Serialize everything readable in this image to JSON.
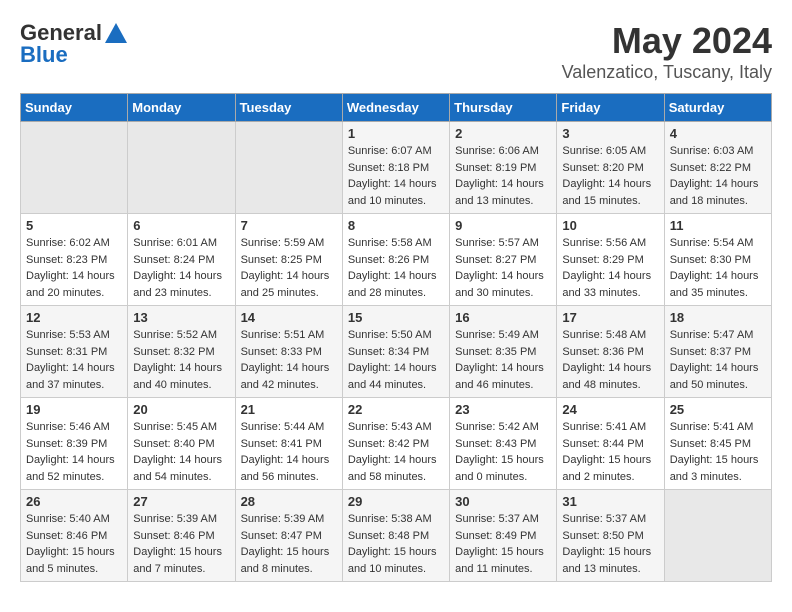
{
  "header": {
    "logo_general": "General",
    "logo_blue": "Blue",
    "month_year": "May 2024",
    "location": "Valenzatico, Tuscany, Italy"
  },
  "days_of_week": [
    "Sunday",
    "Monday",
    "Tuesday",
    "Wednesday",
    "Thursday",
    "Friday",
    "Saturday"
  ],
  "weeks": [
    [
      {
        "day": "",
        "info": ""
      },
      {
        "day": "",
        "info": ""
      },
      {
        "day": "",
        "info": ""
      },
      {
        "day": "1",
        "info": "Sunrise: 6:07 AM\nSunset: 8:18 PM\nDaylight: 14 hours\nand 10 minutes."
      },
      {
        "day": "2",
        "info": "Sunrise: 6:06 AM\nSunset: 8:19 PM\nDaylight: 14 hours\nand 13 minutes."
      },
      {
        "day": "3",
        "info": "Sunrise: 6:05 AM\nSunset: 8:20 PM\nDaylight: 14 hours\nand 15 minutes."
      },
      {
        "day": "4",
        "info": "Sunrise: 6:03 AM\nSunset: 8:22 PM\nDaylight: 14 hours\nand 18 minutes."
      }
    ],
    [
      {
        "day": "5",
        "info": "Sunrise: 6:02 AM\nSunset: 8:23 PM\nDaylight: 14 hours\nand 20 minutes."
      },
      {
        "day": "6",
        "info": "Sunrise: 6:01 AM\nSunset: 8:24 PM\nDaylight: 14 hours\nand 23 minutes."
      },
      {
        "day": "7",
        "info": "Sunrise: 5:59 AM\nSunset: 8:25 PM\nDaylight: 14 hours\nand 25 minutes."
      },
      {
        "day": "8",
        "info": "Sunrise: 5:58 AM\nSunset: 8:26 PM\nDaylight: 14 hours\nand 28 minutes."
      },
      {
        "day": "9",
        "info": "Sunrise: 5:57 AM\nSunset: 8:27 PM\nDaylight: 14 hours\nand 30 minutes."
      },
      {
        "day": "10",
        "info": "Sunrise: 5:56 AM\nSunset: 8:29 PM\nDaylight: 14 hours\nand 33 minutes."
      },
      {
        "day": "11",
        "info": "Sunrise: 5:54 AM\nSunset: 8:30 PM\nDaylight: 14 hours\nand 35 minutes."
      }
    ],
    [
      {
        "day": "12",
        "info": "Sunrise: 5:53 AM\nSunset: 8:31 PM\nDaylight: 14 hours\nand 37 minutes."
      },
      {
        "day": "13",
        "info": "Sunrise: 5:52 AM\nSunset: 8:32 PM\nDaylight: 14 hours\nand 40 minutes."
      },
      {
        "day": "14",
        "info": "Sunrise: 5:51 AM\nSunset: 8:33 PM\nDaylight: 14 hours\nand 42 minutes."
      },
      {
        "day": "15",
        "info": "Sunrise: 5:50 AM\nSunset: 8:34 PM\nDaylight: 14 hours\nand 44 minutes."
      },
      {
        "day": "16",
        "info": "Sunrise: 5:49 AM\nSunset: 8:35 PM\nDaylight: 14 hours\nand 46 minutes."
      },
      {
        "day": "17",
        "info": "Sunrise: 5:48 AM\nSunset: 8:36 PM\nDaylight: 14 hours\nand 48 minutes."
      },
      {
        "day": "18",
        "info": "Sunrise: 5:47 AM\nSunset: 8:37 PM\nDaylight: 14 hours\nand 50 minutes."
      }
    ],
    [
      {
        "day": "19",
        "info": "Sunrise: 5:46 AM\nSunset: 8:39 PM\nDaylight: 14 hours\nand 52 minutes."
      },
      {
        "day": "20",
        "info": "Sunrise: 5:45 AM\nSunset: 8:40 PM\nDaylight: 14 hours\nand 54 minutes."
      },
      {
        "day": "21",
        "info": "Sunrise: 5:44 AM\nSunset: 8:41 PM\nDaylight: 14 hours\nand 56 minutes."
      },
      {
        "day": "22",
        "info": "Sunrise: 5:43 AM\nSunset: 8:42 PM\nDaylight: 14 hours\nand 58 minutes."
      },
      {
        "day": "23",
        "info": "Sunrise: 5:42 AM\nSunset: 8:43 PM\nDaylight: 15 hours\nand 0 minutes."
      },
      {
        "day": "24",
        "info": "Sunrise: 5:41 AM\nSunset: 8:44 PM\nDaylight: 15 hours\nand 2 minutes."
      },
      {
        "day": "25",
        "info": "Sunrise: 5:41 AM\nSunset: 8:45 PM\nDaylight: 15 hours\nand 3 minutes."
      }
    ],
    [
      {
        "day": "26",
        "info": "Sunrise: 5:40 AM\nSunset: 8:46 PM\nDaylight: 15 hours\nand 5 minutes."
      },
      {
        "day": "27",
        "info": "Sunrise: 5:39 AM\nSunset: 8:46 PM\nDaylight: 15 hours\nand 7 minutes."
      },
      {
        "day": "28",
        "info": "Sunrise: 5:39 AM\nSunset: 8:47 PM\nDaylight: 15 hours\nand 8 minutes."
      },
      {
        "day": "29",
        "info": "Sunrise: 5:38 AM\nSunset: 8:48 PM\nDaylight: 15 hours\nand 10 minutes."
      },
      {
        "day": "30",
        "info": "Sunrise: 5:37 AM\nSunset: 8:49 PM\nDaylight: 15 hours\nand 11 minutes."
      },
      {
        "day": "31",
        "info": "Sunrise: 5:37 AM\nSunset: 8:50 PM\nDaylight: 15 hours\nand 13 minutes."
      },
      {
        "day": "",
        "info": ""
      }
    ]
  ]
}
